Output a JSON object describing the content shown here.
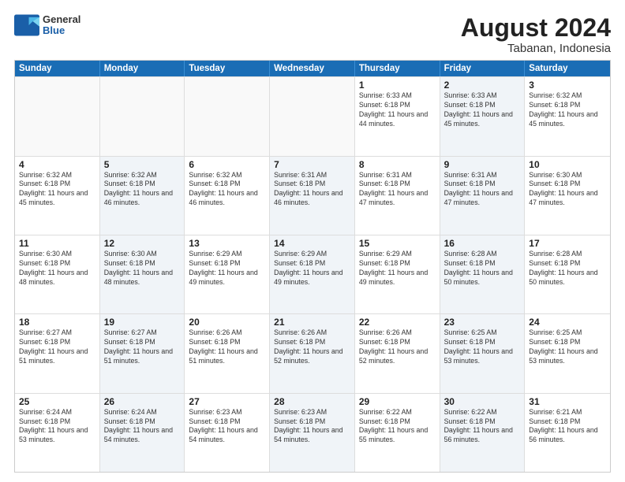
{
  "header": {
    "logo_general": "General",
    "logo_blue": "Blue",
    "title_month": "August 2024",
    "title_location": "Tabanan, Indonesia"
  },
  "days_of_week": [
    "Sunday",
    "Monday",
    "Tuesday",
    "Wednesday",
    "Thursday",
    "Friday",
    "Saturday"
  ],
  "weeks": [
    [
      {
        "day": "",
        "info": "",
        "shaded": false,
        "empty": true
      },
      {
        "day": "",
        "info": "",
        "shaded": false,
        "empty": true
      },
      {
        "day": "",
        "info": "",
        "shaded": false,
        "empty": true
      },
      {
        "day": "",
        "info": "",
        "shaded": false,
        "empty": true
      },
      {
        "day": "1",
        "info": "Sunrise: 6:33 AM\nSunset: 6:18 PM\nDaylight: 11 hours\nand 44 minutes.",
        "shaded": false,
        "empty": false
      },
      {
        "day": "2",
        "info": "Sunrise: 6:33 AM\nSunset: 6:18 PM\nDaylight: 11 hours\nand 45 minutes.",
        "shaded": true,
        "empty": false
      },
      {
        "day": "3",
        "info": "Sunrise: 6:32 AM\nSunset: 6:18 PM\nDaylight: 11 hours\nand 45 minutes.",
        "shaded": false,
        "empty": false
      }
    ],
    [
      {
        "day": "4",
        "info": "Sunrise: 6:32 AM\nSunset: 6:18 PM\nDaylight: 11 hours\nand 45 minutes.",
        "shaded": false,
        "empty": false
      },
      {
        "day": "5",
        "info": "Sunrise: 6:32 AM\nSunset: 6:18 PM\nDaylight: 11 hours\nand 46 minutes.",
        "shaded": true,
        "empty": false
      },
      {
        "day": "6",
        "info": "Sunrise: 6:32 AM\nSunset: 6:18 PM\nDaylight: 11 hours\nand 46 minutes.",
        "shaded": false,
        "empty": false
      },
      {
        "day": "7",
        "info": "Sunrise: 6:31 AM\nSunset: 6:18 PM\nDaylight: 11 hours\nand 46 minutes.",
        "shaded": true,
        "empty": false
      },
      {
        "day": "8",
        "info": "Sunrise: 6:31 AM\nSunset: 6:18 PM\nDaylight: 11 hours\nand 47 minutes.",
        "shaded": false,
        "empty": false
      },
      {
        "day": "9",
        "info": "Sunrise: 6:31 AM\nSunset: 6:18 PM\nDaylight: 11 hours\nand 47 minutes.",
        "shaded": true,
        "empty": false
      },
      {
        "day": "10",
        "info": "Sunrise: 6:30 AM\nSunset: 6:18 PM\nDaylight: 11 hours\nand 47 minutes.",
        "shaded": false,
        "empty": false
      }
    ],
    [
      {
        "day": "11",
        "info": "Sunrise: 6:30 AM\nSunset: 6:18 PM\nDaylight: 11 hours\nand 48 minutes.",
        "shaded": false,
        "empty": false
      },
      {
        "day": "12",
        "info": "Sunrise: 6:30 AM\nSunset: 6:18 PM\nDaylight: 11 hours\nand 48 minutes.",
        "shaded": true,
        "empty": false
      },
      {
        "day": "13",
        "info": "Sunrise: 6:29 AM\nSunset: 6:18 PM\nDaylight: 11 hours\nand 49 minutes.",
        "shaded": false,
        "empty": false
      },
      {
        "day": "14",
        "info": "Sunrise: 6:29 AM\nSunset: 6:18 PM\nDaylight: 11 hours\nand 49 minutes.",
        "shaded": true,
        "empty": false
      },
      {
        "day": "15",
        "info": "Sunrise: 6:29 AM\nSunset: 6:18 PM\nDaylight: 11 hours\nand 49 minutes.",
        "shaded": false,
        "empty": false
      },
      {
        "day": "16",
        "info": "Sunrise: 6:28 AM\nSunset: 6:18 PM\nDaylight: 11 hours\nand 50 minutes.",
        "shaded": true,
        "empty": false
      },
      {
        "day": "17",
        "info": "Sunrise: 6:28 AM\nSunset: 6:18 PM\nDaylight: 11 hours\nand 50 minutes.",
        "shaded": false,
        "empty": false
      }
    ],
    [
      {
        "day": "18",
        "info": "Sunrise: 6:27 AM\nSunset: 6:18 PM\nDaylight: 11 hours\nand 51 minutes.",
        "shaded": false,
        "empty": false
      },
      {
        "day": "19",
        "info": "Sunrise: 6:27 AM\nSunset: 6:18 PM\nDaylight: 11 hours\nand 51 minutes.",
        "shaded": true,
        "empty": false
      },
      {
        "day": "20",
        "info": "Sunrise: 6:26 AM\nSunset: 6:18 PM\nDaylight: 11 hours\nand 51 minutes.",
        "shaded": false,
        "empty": false
      },
      {
        "day": "21",
        "info": "Sunrise: 6:26 AM\nSunset: 6:18 PM\nDaylight: 11 hours\nand 52 minutes.",
        "shaded": true,
        "empty": false
      },
      {
        "day": "22",
        "info": "Sunrise: 6:26 AM\nSunset: 6:18 PM\nDaylight: 11 hours\nand 52 minutes.",
        "shaded": false,
        "empty": false
      },
      {
        "day": "23",
        "info": "Sunrise: 6:25 AM\nSunset: 6:18 PM\nDaylight: 11 hours\nand 53 minutes.",
        "shaded": true,
        "empty": false
      },
      {
        "day": "24",
        "info": "Sunrise: 6:25 AM\nSunset: 6:18 PM\nDaylight: 11 hours\nand 53 minutes.",
        "shaded": false,
        "empty": false
      }
    ],
    [
      {
        "day": "25",
        "info": "Sunrise: 6:24 AM\nSunset: 6:18 PM\nDaylight: 11 hours\nand 53 minutes.",
        "shaded": false,
        "empty": false
      },
      {
        "day": "26",
        "info": "Sunrise: 6:24 AM\nSunset: 6:18 PM\nDaylight: 11 hours\nand 54 minutes.",
        "shaded": true,
        "empty": false
      },
      {
        "day": "27",
        "info": "Sunrise: 6:23 AM\nSunset: 6:18 PM\nDaylight: 11 hours\nand 54 minutes.",
        "shaded": false,
        "empty": false
      },
      {
        "day": "28",
        "info": "Sunrise: 6:23 AM\nSunset: 6:18 PM\nDaylight: 11 hours\nand 54 minutes.",
        "shaded": true,
        "empty": false
      },
      {
        "day": "29",
        "info": "Sunrise: 6:22 AM\nSunset: 6:18 PM\nDaylight: 11 hours\nand 55 minutes.",
        "shaded": false,
        "empty": false
      },
      {
        "day": "30",
        "info": "Sunrise: 6:22 AM\nSunset: 6:18 PM\nDaylight: 11 hours\nand 56 minutes.",
        "shaded": true,
        "empty": false
      },
      {
        "day": "31",
        "info": "Sunrise: 6:21 AM\nSunset: 6:18 PM\nDaylight: 11 hours\nand 56 minutes.",
        "shaded": false,
        "empty": false
      }
    ]
  ]
}
